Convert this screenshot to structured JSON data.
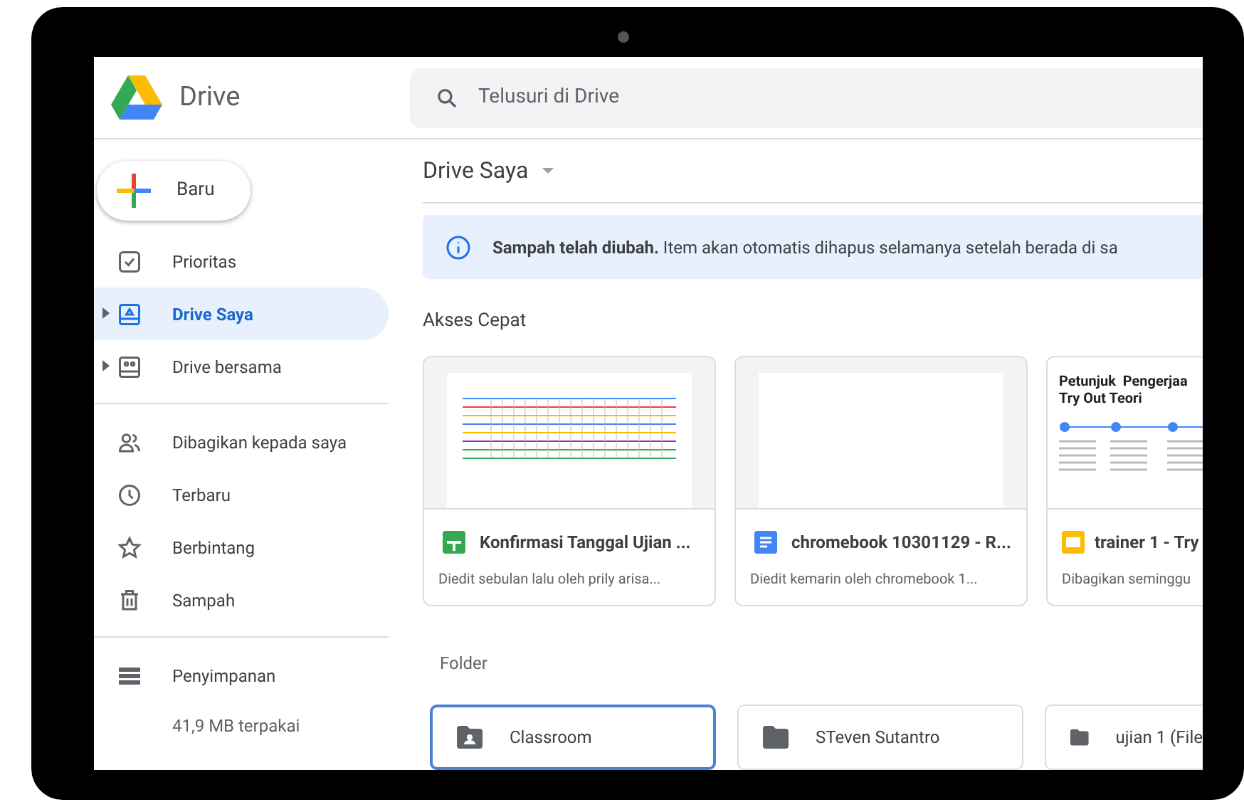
{
  "header": {
    "app_name": "Drive",
    "search": {
      "placeholder": "Telusuri di Drive"
    }
  },
  "sidebar": {
    "new_button": "Baru",
    "groups": [
      {
        "items": [
          {
            "label": "Prioritas",
            "kind": "priority",
            "selected": false,
            "expandable": false
          },
          {
            "label": "Drive Saya",
            "kind": "mydrive",
            "selected": true,
            "expandable": true
          },
          {
            "label": "Drive bersama",
            "kind": "shared",
            "selected": false,
            "expandable": true
          }
        ]
      },
      {
        "items": [
          {
            "label": "Dibagikan kepada saya",
            "kind": "people",
            "selected": false,
            "expandable": false
          },
          {
            "label": "Terbaru",
            "kind": "recent",
            "selected": false,
            "expandable": false
          },
          {
            "label": "Berbintang",
            "kind": "star",
            "selected": false,
            "expandable": false
          },
          {
            "label": "Sampah",
            "kind": "trash",
            "selected": false,
            "expandable": false
          }
        ]
      },
      {
        "items": [
          {
            "label": "Penyimpanan",
            "kind": "storage",
            "selected": false,
            "expandable": false
          }
        ]
      }
    ],
    "storage_used": "41,9 MB terpakai"
  },
  "main": {
    "title": "Drive Saya",
    "banner": "**Sampah telah diubah.** Item akan otomatis dihapus selamanya setelah berada di sa",
    "quick_access": {
      "heading": "Akses Cepat",
      "files": [
        {
          "kind": "sheet",
          "name": "Konfirmasi Tanggal Ujian ...",
          "detail": "Diedit sebulan lalu oleh prily arisa..."
        },
        {
          "kind": "doc",
          "name": "chromebook 10301129 - R...",
          "detail": "Diedit kemarin oleh chromebook 1..."
        },
        {
          "kind": "slide",
          "name": "trainer 1 - Try",
          "detail": "Dibagikan seminggu",
          "preview_title": "Petunjuk  Pengerjaa",
          "preview_subtitle": "Try Out Teori"
        }
      ]
    },
    "folders": {
      "heading": "Folder",
      "items": [
        {
          "kind": "shared",
          "name": "Classroom",
          "selected": true
        },
        {
          "kind": "plain",
          "name": "STeven Sutantro",
          "selected": false
        },
        {
          "kind": "plain",
          "name": "ujian 1 (File",
          "selected": false
        }
      ]
    }
  }
}
